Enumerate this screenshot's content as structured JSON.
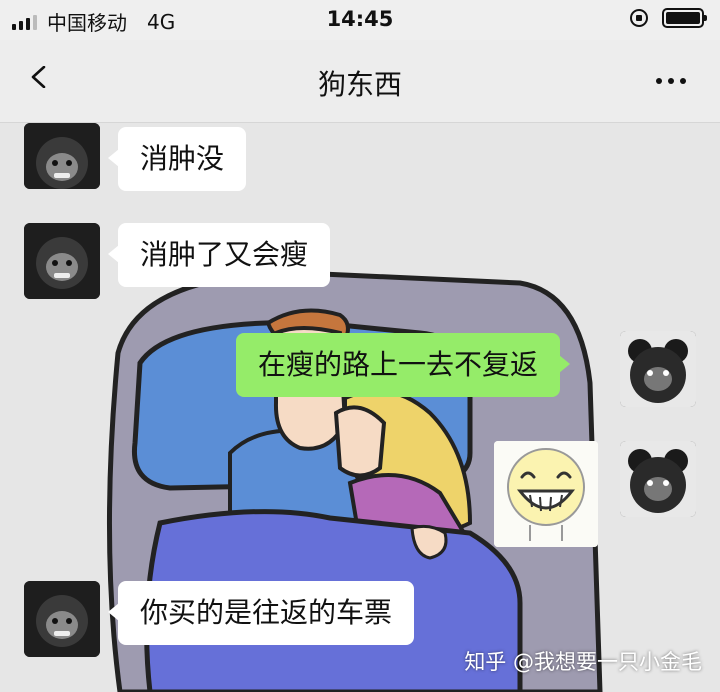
{
  "statusbar": {
    "carrier": "中国移动",
    "network": "4G",
    "time": "14:45"
  },
  "nav": {
    "title": "狗东西",
    "back_icon": "chevron-left-icon",
    "more_icon": "more-dots-icon"
  },
  "messages": [
    {
      "side": "in",
      "text": "消肿没"
    },
    {
      "side": "in",
      "text": "消肿了又会瘦"
    },
    {
      "side": "out",
      "text": "在瘦的路上一去不复返"
    },
    {
      "side": "out",
      "type": "sticker",
      "sticker": "laughing-face-sticker"
    },
    {
      "side": "in",
      "text": "你买的是往返的车票"
    }
  ],
  "watermark": "知乎 @我想要一只小金毛",
  "colors": {
    "outgoing_bubble": "#95ec69",
    "incoming_bubble": "#ffffff"
  }
}
